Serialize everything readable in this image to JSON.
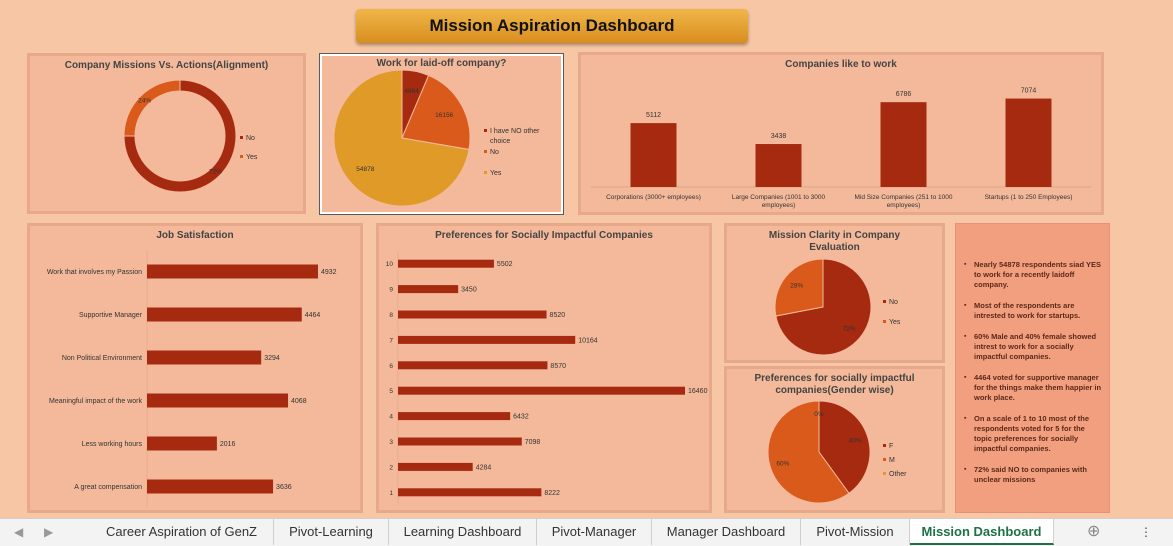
{
  "title": "Mission Aspiration Dashboard",
  "chart_data": [
    {
      "type": "pie",
      "variant": "donut",
      "title": "Company Missions Vs. Actions(Alignment)",
      "labels": [
        "No",
        "Yes"
      ],
      "values": [
        72,
        24
      ],
      "value_labels": [
        "72%",
        "24%"
      ],
      "colors": [
        "#a52a10",
        "#d95a1a"
      ]
    },
    {
      "type": "pie",
      "title": "Work for laid-off company?",
      "labels": [
        "I have NO other choice",
        "No",
        "Yes"
      ],
      "values": [
        4864,
        16156,
        54878
      ],
      "value_labels": [
        "4864",
        "16156",
        "54878"
      ],
      "colors": [
        "#a52a10",
        "#d95a1a",
        "#e09a28"
      ]
    },
    {
      "type": "bar",
      "title": "Companies like to work",
      "categories": [
        "Corporations (3000+ employees)",
        "Large Companies (1001 to 3000 employees)",
        "Mid Size Companies (251 to 1000 employees)",
        "Startups (1 to 250 Employees)"
      ],
      "values": [
        5112,
        3438,
        6786,
        7074
      ],
      "value_labels": [
        "5112",
        "3438",
        "6786",
        "7074"
      ]
    },
    {
      "type": "bar",
      "orientation": "horizontal",
      "title": "Job Satisfaction",
      "categories": [
        "Work that involves my Passion",
        "Supportive Manager",
        "Non Political Environment",
        "Meaningful impact of the work",
        "Less working hours",
        "A great compensation"
      ],
      "values": [
        4932,
        4464,
        3294,
        4068,
        2016,
        3636
      ],
      "value_labels": [
        "4932",
        "4464",
        "3294",
        "4068",
        "2016",
        "3636"
      ]
    },
    {
      "type": "bar",
      "orientation": "horizontal",
      "title": "Preferences for Socially Impactful Companies",
      "categories": [
        "10",
        "9",
        "8",
        "7",
        "6",
        "5",
        "4",
        "3",
        "2",
        "1"
      ],
      "values": [
        5502,
        3450,
        8520,
        10164,
        8570,
        16460,
        6432,
        7098,
        4284,
        8222
      ],
      "value_labels": [
        "5502",
        "3450",
        "8520",
        "10164",
        "8570",
        "16460",
        "6432",
        "7098",
        "4284",
        "8222"
      ]
    },
    {
      "type": "pie",
      "title": "Mission Clarity in Company Evaluation",
      "labels": [
        "No",
        "Yes"
      ],
      "values": [
        72,
        28
      ],
      "value_labels": [
        "72%",
        "28%"
      ],
      "colors": [
        "#a52a10",
        "#d95a1a"
      ]
    },
    {
      "type": "pie",
      "title": "Preferences for socially impactful companies(Gender wise)",
      "labels": [
        "F",
        "M",
        "Other"
      ],
      "values": [
        40,
        60,
        0
      ],
      "value_labels": [
        "40%",
        "60%",
        "0%"
      ],
      "colors": [
        "#a52a10",
        "#d95a1a",
        "#e09a28"
      ]
    }
  ],
  "insights": [
    "Nearly 54878 respondents siad YES to work for a recently laidoff company.",
    "Most of the respondents are intrested to work for startups.",
    "60% Male and 40% female showed intrest to work for a socially impactful companies.",
    "4464 voted for supportive manager for the things make them happier in work place.",
    "On a scale of 1 to 10 most of the respondents voted for 5 for the topic preferences for socially impactful companies.",
    "72% said NO to companies with unclear missions"
  ],
  "tabs": [
    "Career Aspiration of GenZ",
    "Pivot-Learning",
    "Learning Dashboard",
    "Pivot-Manager",
    "Manager Dashboard",
    "Pivot-Mission",
    "Mission Dashboard"
  ],
  "active_tab": "Mission Dashboard",
  "bar_color": "#a52a10"
}
